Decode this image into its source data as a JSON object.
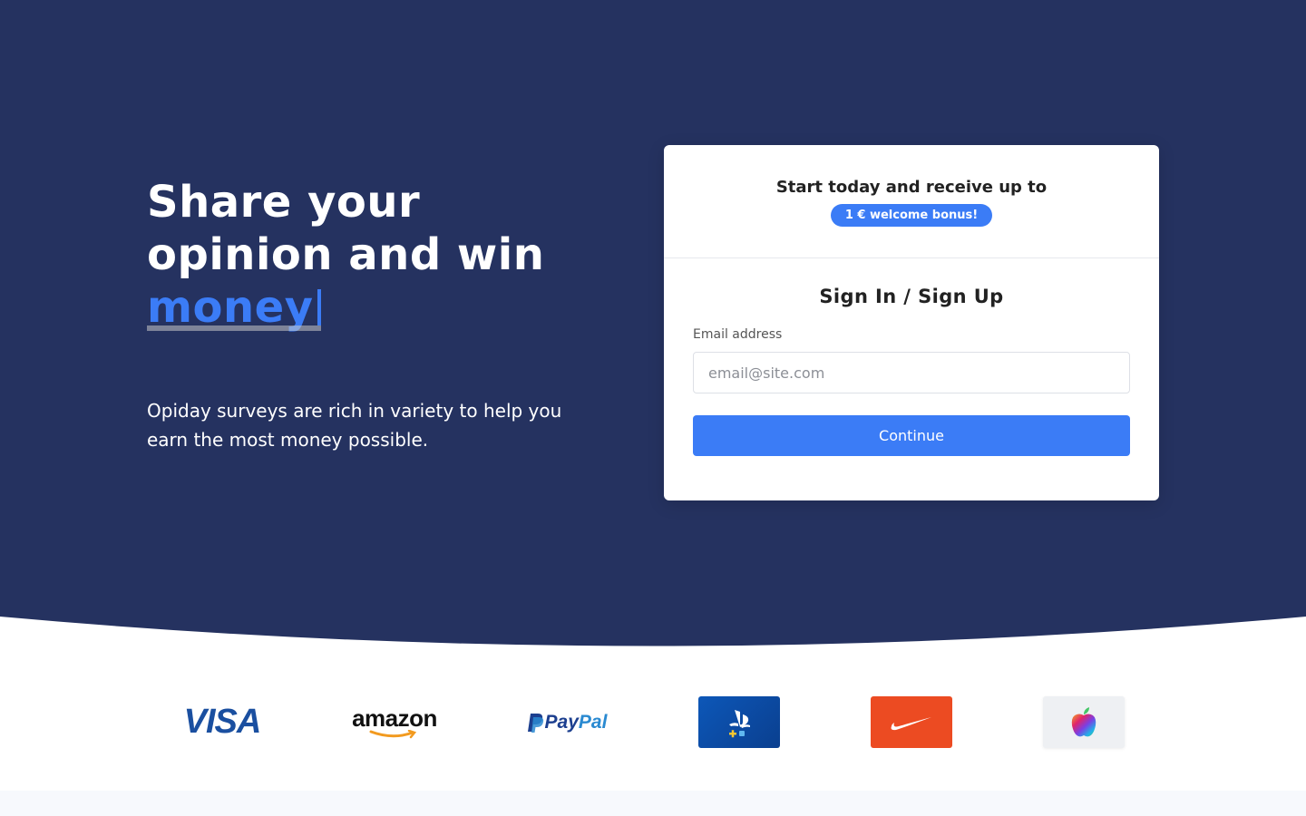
{
  "hero": {
    "headline_line1": "Share your",
    "headline_line2": "opinion and win",
    "headline_accent": "money",
    "subtext": "Opiday surveys are rich in variety to help you earn the most money possible."
  },
  "card": {
    "promo_title": "Start today and receive up to",
    "bonus_badge": "1 € welcome bonus!",
    "form_title": "Sign In / Sign Up",
    "email_label": "Email address",
    "email_placeholder": "email@site.com",
    "email_value": "",
    "continue_label": "Continue"
  },
  "logos": [
    {
      "name": "visa",
      "text": "VISA"
    },
    {
      "name": "amazon",
      "text": "amazon"
    },
    {
      "name": "paypal",
      "text_a": "Pay",
      "text_b": "Pal"
    },
    {
      "name": "playstation",
      "icon": "playstation-plus-icon"
    },
    {
      "name": "nike",
      "icon": "nike-swoosh-icon"
    },
    {
      "name": "apple",
      "icon": "apple-icon"
    }
  ],
  "colors": {
    "hero_background": "#253260",
    "accent": "#3b7cf6",
    "nike_card": "#ec4b22",
    "psn_card": "#0d57b8"
  }
}
